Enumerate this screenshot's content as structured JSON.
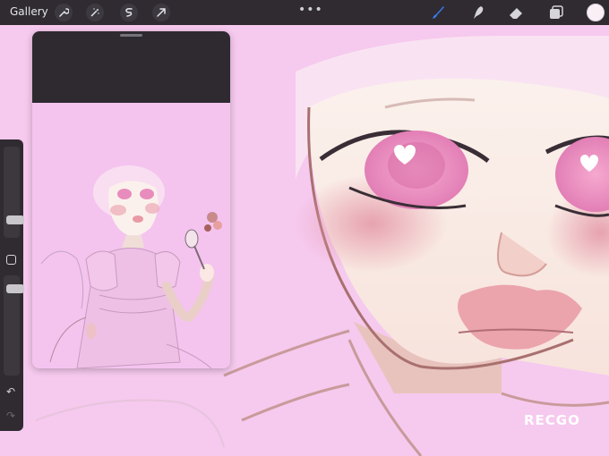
{
  "topbar": {
    "gallery_label": "Gallery",
    "left_tools": [
      "wrench-icon",
      "magic-wand-icon",
      "selection-icon",
      "transform-arrow-icon"
    ],
    "menu_dots": "•••",
    "right_tools": [
      "brush-icon",
      "smudge-icon",
      "eraser-icon",
      "layers-icon"
    ],
    "current_color": "#fbeff6"
  },
  "sidebar": {
    "size_slider_icon": "brush-size-slider",
    "opacity_slider_icon": "opacity-slider",
    "modifier_icon": "modifier-square-icon",
    "undo_icon": "↶",
    "redo_icon": "↷"
  },
  "reference_window": {
    "icon": "reference-drag-handle"
  },
  "watermark": {
    "text": "RECGO"
  },
  "colors": {
    "toolbar_bg": "#2f2b31",
    "canvas_pink": "#f6c9ee",
    "brush_active": "#3a7bf2"
  }
}
